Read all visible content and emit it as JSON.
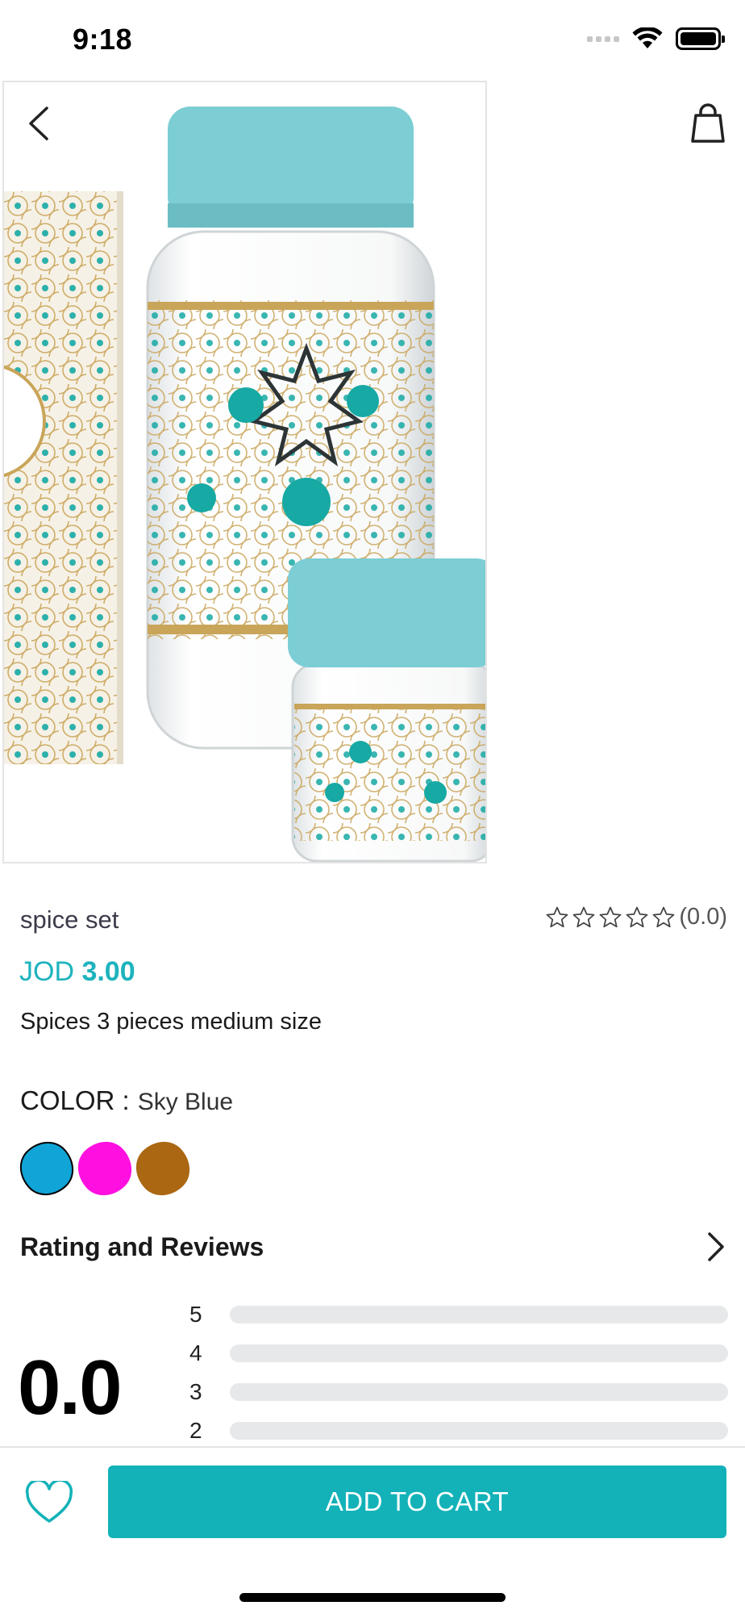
{
  "status_bar": {
    "time": "9:18"
  },
  "header": {
    "back_icon": "chevron-left-icon",
    "cart_icon": "shopping-bag-icon"
  },
  "product": {
    "name": "spice set",
    "rating_text": "(0.0)",
    "star_count": 5,
    "currency": "JOD",
    "price": "3.00",
    "description": "Spices 3 pieces medium size",
    "color_label": "COLOR :",
    "color_value": "Sky Blue",
    "colors": [
      "#11a4d6",
      "#ff10e0",
      "#ab6712"
    ],
    "selected_color": 0
  },
  "reviews": {
    "title": "Rating and Reviews",
    "score": "0.0",
    "bars": [
      {
        "stars": "5",
        "fraction": 0
      },
      {
        "stars": "4",
        "fraction": 0
      },
      {
        "stars": "3",
        "fraction": 0
      },
      {
        "stars": "2",
        "fraction": 0
      }
    ]
  },
  "footer": {
    "add_to_cart": "ADD TO CART",
    "favorite_icon": "heart-icon"
  },
  "colors": {
    "accent": "#12b2b8",
    "jar_lid": "#7ccdd4",
    "pattern_teal": "#17a9a4",
    "gold": "#c9a55a"
  }
}
